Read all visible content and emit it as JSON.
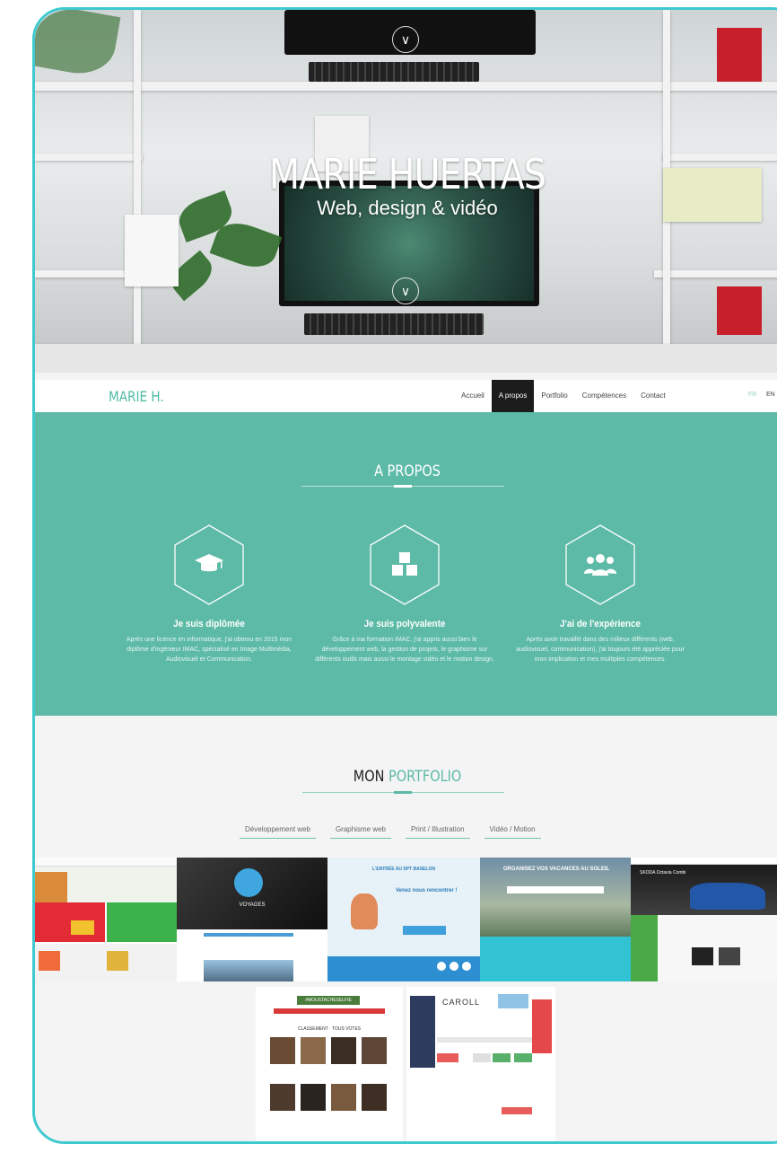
{
  "hero": {
    "title": "MARIE HUERTAS",
    "subtitle": "Web, design & vidéo"
  },
  "nav": {
    "brand": "MARIE H.",
    "items": [
      {
        "label": "Accueil",
        "active": false
      },
      {
        "label": "A propos",
        "active": true
      },
      {
        "label": "Portfolio",
        "active": false
      },
      {
        "label": "Compétences",
        "active": false
      },
      {
        "label": "Contact",
        "active": false
      }
    ],
    "lang_fr": "FR",
    "lang_en": "EN"
  },
  "about": {
    "title": "A PROPOS",
    "features": [
      {
        "icon": "graduation-cap-icon",
        "title": "Je suis diplômée",
        "text": "Après une licence en informatique, j'ai obtenu en 2015 mon diplôme d'ingénieur IMAC, spécialisé en Image Multimédia, Audiovisuel et Communication."
      },
      {
        "icon": "cubes-icon",
        "title": "Je suis polyvalente",
        "text": "Grâce à ma formation IMAC, j'ai appris aussi bien le développement web, la gestion de projets, le graphisme sur différents outils mais aussi le montage vidéo et le motion design."
      },
      {
        "icon": "users-icon",
        "title": "J'ai de l'expérience",
        "text": "Après avoir travaillé dans des milieux différents (web, audiovisuel, communication), j'ai toujours été appréciée pour mon implication et mes multiples compétences."
      }
    ]
  },
  "portfolio": {
    "title_a": "MON",
    "title_b": "PORTFOLIO",
    "filters": [
      "Développement web",
      "Graphisme web",
      "Print / Illustration",
      "Vidéo / Motion"
    ],
    "thumbs": {
      "t2_heading": "VOYAGES",
      "t3_heading": "L'ENTRÉE AU SPT BASELON",
      "t3_sub": "Venez nous rencontrer !",
      "t4_heading": "ORGANISEZ VOS VACANCES AU SOLEIL",
      "t5_heading": "SKODA Octavia Combi",
      "t6_tag": "#MOUSTACHESELFIE",
      "t6_sub": "CLASSEMENT · TOUS VOTES",
      "t7_brand": "CAROLL"
    }
  },
  "colors": {
    "accent": "#5cbaa7",
    "frame": "#3ec9cf",
    "nav_active": "#1c1c1c"
  }
}
